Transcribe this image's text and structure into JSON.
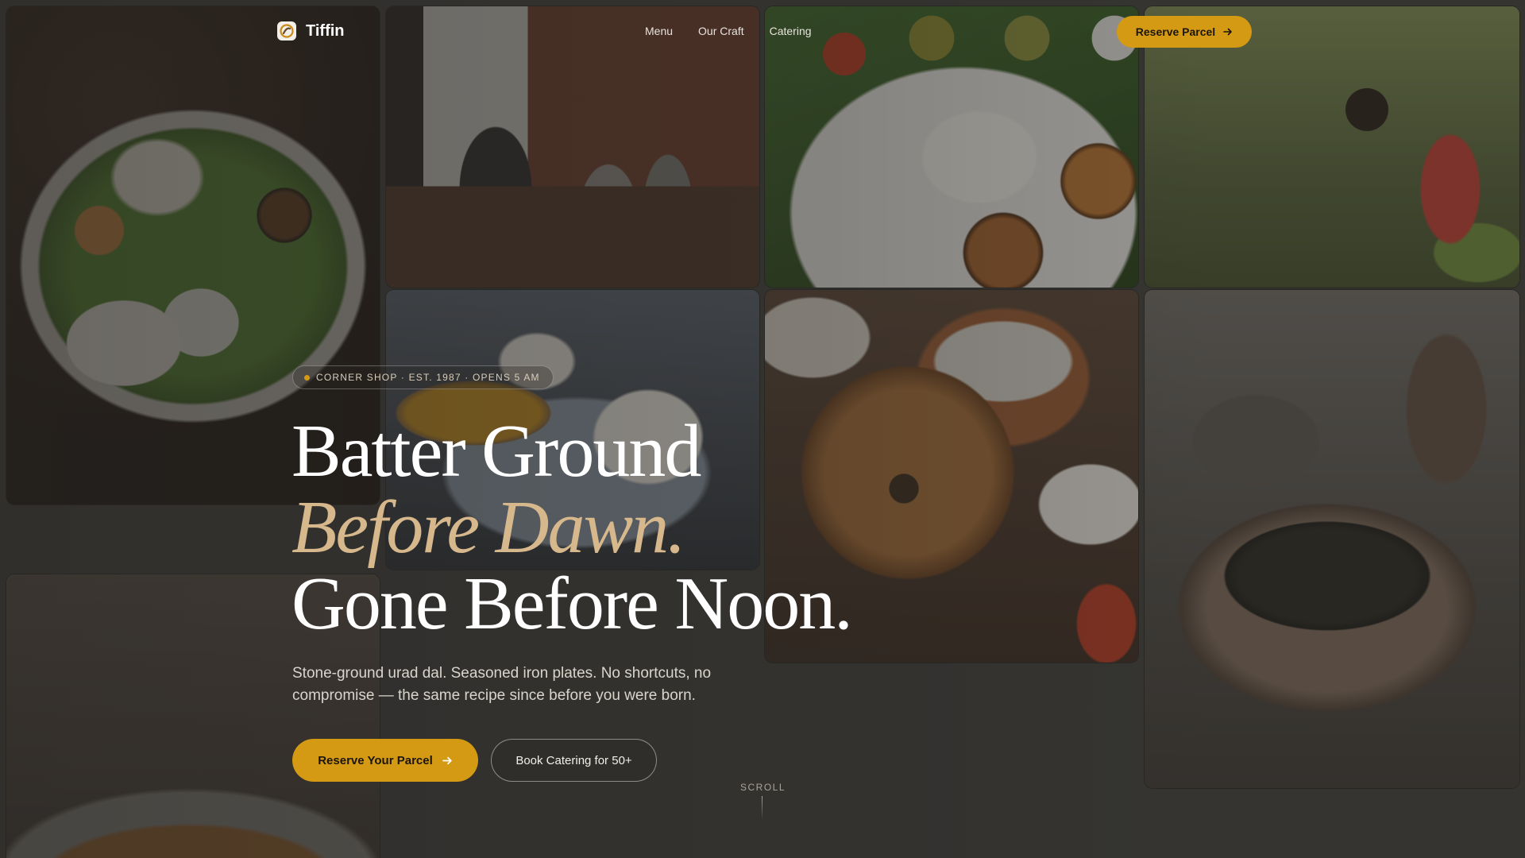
{
  "nav": {
    "brand": "Tiffin",
    "logo_icon": "spiral-logo-icon",
    "links": [
      "Menu",
      "Our Craft",
      "Catering"
    ],
    "cta_label": "Reserve Parcel",
    "cta_icon": "arrow-right-icon"
  },
  "hero": {
    "badge": "CORNER SHOP · EST. 1987 · OPENS 5 AM",
    "headline_line1": "Batter Ground",
    "headline_line2": "Before Dawn.",
    "headline_line3": "Gone Before Noon.",
    "subcopy": "Stone-ground urad dal. Seasoned iron plates. No shortcuts, no compromise — the same recipe since before you were born.",
    "primary_cta": "Reserve Your Parcel",
    "secondary_cta": "Book Catering for 50+",
    "scroll_label": "SCROLL"
  },
  "colors": {
    "accent": "#d59a14",
    "headline_accent": "#d7b88d",
    "background": "#353431"
  }
}
